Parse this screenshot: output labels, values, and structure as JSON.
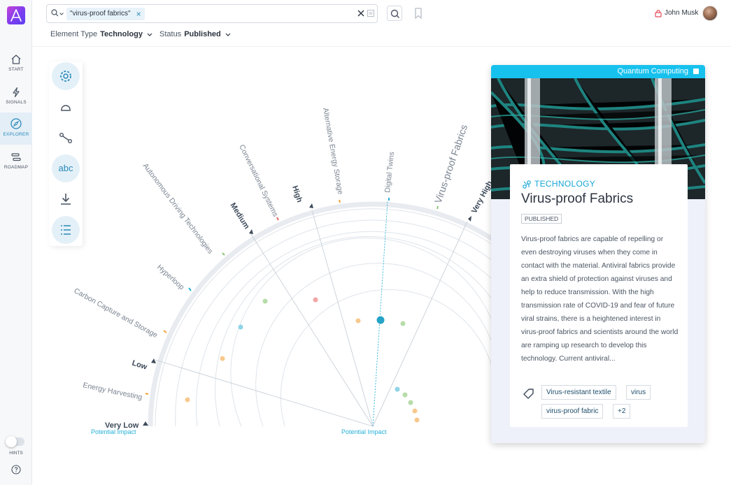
{
  "nav": {
    "items": [
      {
        "label": "START",
        "icon": "home-icon"
      },
      {
        "label": "SIGNALS",
        "icon": "bolt-icon"
      },
      {
        "label": "EXPLORER",
        "icon": "compass-icon",
        "active": true
      },
      {
        "label": "ROADMAP",
        "icon": "roadmap-icon"
      }
    ],
    "hints_label": "HINTS"
  },
  "search": {
    "chip": "\"virus-proof fabrics\"",
    "chip_remove": "×"
  },
  "user": {
    "name": "John Musk"
  },
  "filters": {
    "element_type_label": "Element Type",
    "element_type_value": "Technology",
    "status_label": "Status",
    "status_value": "Published"
  },
  "tools": {
    "abc_label": "abc"
  },
  "radar": {
    "ring_labels": [
      "Very Low",
      "Low",
      "Medium",
      "High",
      "Very High"
    ],
    "axis_label_left": "Potential Impact",
    "axis_label_bottom": "Potential Impact",
    "items": [
      {
        "label": "Energy Harvesting",
        "color": "#f1a23a"
      },
      {
        "label": "Carbon Capture and Storage",
        "color": "#f1a23a"
      },
      {
        "label": "Hyperloop",
        "color": "#25b0d8"
      },
      {
        "label": "Autonomous Driving Technologies",
        "color": "#8bc37a"
      },
      {
        "label": "Conversational Systems",
        "color": "#e36b6b"
      },
      {
        "label": "Alternative Energy Storage",
        "color": "#f1a23a"
      },
      {
        "label": "Digital Twins",
        "color": "#25b0d8"
      },
      {
        "label": "Virus-proof Fabrics",
        "color": "#8bc37a"
      }
    ]
  },
  "card": {
    "category": "Quantum Computing",
    "type": "TECHNOLOGY",
    "title": "Virus-proof Fabrics",
    "status": "PUBLISHED",
    "description": "Virus-proof fabrics are capable of repelling or even destroying viruses when they come in contact with the material. Antiviral fabrics provide an extra shield of protection against viruses and help to reduce transmission. With the high transmission rate of COVID-19 and fear of future viral strains, there is a heightened interest in virus-proof fabrics and scientists around the world are ramping up research to develop this technology. Current antiviral...",
    "tags": [
      "Virus-resistant textile",
      "virus",
      "virus-proof fabric",
      "+2"
    ]
  }
}
